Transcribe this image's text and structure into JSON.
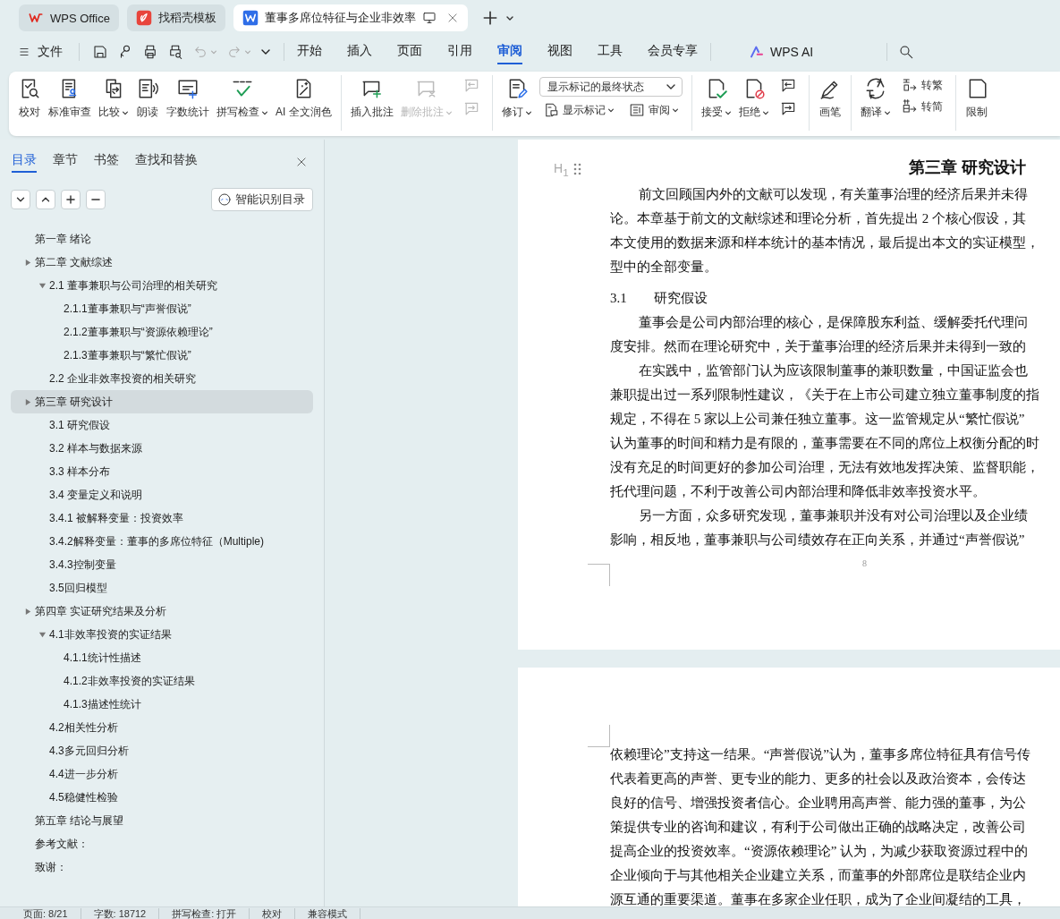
{
  "tabs": [
    {
      "label": "WPS Office",
      "kind": "wps",
      "selected": false
    },
    {
      "label": "找稻壳模板",
      "kind": "docer",
      "selected": false
    },
    {
      "label": "董事多席位特征与企业非效率",
      "kind": "doc",
      "selected": true
    }
  ],
  "menu": {
    "file": "文件",
    "tabs": [
      {
        "label": "开始",
        "selected": false
      },
      {
        "label": "插入",
        "selected": false
      },
      {
        "label": "页面",
        "selected": false
      },
      {
        "label": "引用",
        "selected": false
      },
      {
        "label": "审阅",
        "selected": true
      },
      {
        "label": "视图",
        "selected": false
      },
      {
        "label": "工具",
        "selected": false
      },
      {
        "label": "会员专享",
        "selected": false
      }
    ],
    "ai": "WPS AI"
  },
  "ribbon": {
    "groups": [
      {
        "items": [
          {
            "kind": "large",
            "label": "校对",
            "dropdown": false,
            "disabled": false
          },
          {
            "kind": "large",
            "label": "标准审查",
            "dropdown": false,
            "disabled": false
          },
          {
            "kind": "large",
            "label": "比较",
            "dropdown": true,
            "disabled": false
          },
          {
            "kind": "large",
            "label": "朗读",
            "dropdown": false,
            "disabled": false
          },
          {
            "kind": "large",
            "label": "字数统计",
            "dropdown": false,
            "disabled": false
          },
          {
            "kind": "large",
            "label": "拼写检查",
            "dropdown": true,
            "disabled": false
          },
          {
            "kind": "large",
            "label": "AI 全文润色",
            "dropdown": false,
            "disabled": false
          }
        ]
      },
      {
        "items": [
          {
            "kind": "large",
            "label": "插入批注",
            "dropdown": false,
            "disabled": false
          },
          {
            "kind": "large",
            "label": "删除批注",
            "dropdown": true,
            "disabled": true
          },
          {
            "kind": "stack",
            "items": [
              {
                "kind": "icon",
                "disabled": true
              },
              {
                "kind": "icon",
                "disabled": true
              }
            ]
          }
        ]
      },
      {
        "items": [
          {
            "kind": "large",
            "label": "修订",
            "dropdown": true,
            "disabled": false
          },
          {
            "kind": "stack",
            "items": [
              {
                "kind": "select",
                "value": "显示标记的最终状态"
              },
              {
                "kind": "row",
                "items": [
                  {
                    "kind": "small",
                    "label": "显示标记",
                    "dropdown": true,
                    "disabled": false
                  },
                  {
                    "kind": "small",
                    "label": "审阅",
                    "dropdown": true,
                    "disabled": false
                  }
                ]
              }
            ]
          }
        ]
      },
      {
        "items": [
          {
            "kind": "large",
            "label": "接受",
            "dropdown": true,
            "disabled": false
          },
          {
            "kind": "large",
            "label": "拒绝",
            "dropdown": true,
            "disabled": false
          },
          {
            "kind": "stack",
            "items": [
              {
                "kind": "icon",
                "disabled": false
              },
              {
                "kind": "icon",
                "disabled": false
              }
            ]
          }
        ]
      },
      {
        "items": [
          {
            "kind": "large",
            "label": "画笔",
            "dropdown": false,
            "disabled": false
          }
        ]
      },
      {
        "items": [
          {
            "kind": "large",
            "label": "翻译",
            "dropdown": true,
            "disabled": false
          },
          {
            "kind": "stack",
            "items": [
              {
                "kind": "small",
                "label": "转繁",
                "dropdown": false,
                "disabled": false
              },
              {
                "kind": "small",
                "label": "转简",
                "dropdown": false,
                "disabled": false
              }
            ]
          }
        ]
      },
      {
        "items": [
          {
            "kind": "large",
            "label": "限制",
            "dropdown": false,
            "disabled": false
          }
        ]
      }
    ]
  },
  "sidebar": {
    "tabs": [
      {
        "label": "目录",
        "selected": true
      },
      {
        "label": "章节",
        "selected": false
      },
      {
        "label": "书签",
        "selected": false
      },
      {
        "label": "查找和替换",
        "selected": false
      }
    ],
    "smart_toc": "智能识别目录",
    "toc": [
      {
        "label": "第一章  绪论",
        "selected": false
      },
      {
        "label": "第二章  文献综述",
        "selected": false,
        "expanded": false,
        "children": [
          {
            "label": "2.1  董事兼职与公司治理的相关研究",
            "selected": false,
            "expanded": true,
            "children": [
              {
                "label": "2.1.1董事兼职与“声誉假说”",
                "selected": false
              },
              {
                "label": "2.1.2董事兼职与“资源依赖理论”",
                "selected": false
              },
              {
                "label": "2.1.3董事兼职与“繁忙假说”",
                "selected": false
              }
            ]
          },
          {
            "label": "2.2  企业非效率投资的相关研究",
            "selected": false
          }
        ]
      },
      {
        "label": "第三章  研究设计",
        "selected": true,
        "expanded": false,
        "children": [
          {
            "label": "3.1  研究假设",
            "selected": false
          },
          {
            "label": "3.2  样本与数据来源",
            "selected": false
          },
          {
            "label": "3.3  样本分布",
            "selected": false
          },
          {
            "label": "3.4  变量定义和说明",
            "selected": false
          },
          {
            "label": "3.4.1  被解释变量：投资效率",
            "selected": false
          },
          {
            "label": "3.4.2解释变量：董事的多席位特征（Multiple)",
            "selected": false
          },
          {
            "label": "3.4.3控制变量",
            "selected": false
          },
          {
            "label": "3.5回归模型",
            "selected": false
          }
        ]
      },
      {
        "label": "第四章  实证研究结果及分析",
        "selected": false,
        "expanded": false,
        "children": [
          {
            "label": "4.1非效率投资的实证结果",
            "selected": false,
            "expanded": true,
            "children": [
              {
                "label": "4.1.1统计性描述",
                "selected": false
              },
              {
                "label": "4.1.2非效率投资的实证结果",
                "selected": false
              },
              {
                "label": "4.1.3描述性统计",
                "selected": false
              }
            ]
          },
          {
            "label": "4.2相关性分析",
            "selected": false
          },
          {
            "label": "4.3多元回归分析",
            "selected": false
          },
          {
            "label": "4.4进一步分析",
            "selected": false
          },
          {
            "label": "4.5稳健性检验",
            "selected": false
          }
        ]
      },
      {
        "label": "第五章  结论与展望",
        "selected": false
      },
      {
        "label": "参考文献：",
        "selected": false
      },
      {
        "label": "致谢：",
        "selected": false
      }
    ]
  },
  "document": {
    "pages": [
      {
        "heading_marker": "H$_{1}$",
        "page_number": "8",
        "blocks": [
          {
            "kind": "title",
            "text": "第三章  研究设计"
          },
          {
            "kind": "para",
            "lines": [
              "前文回顾国内外的文献可以发现，有关董事治理的经济后果并未得",
              "论。本章基于前文的文献综述和理论分析，首先提出 2 个核心假设，其",
              "本文使用的数据来源和样本统计的基本情况，最后提出本文的实证模型，",
              "型中的全部变量。"
            ]
          },
          {
            "kind": "section",
            "number": "3.1",
            "text": "研究假设"
          },
          {
            "kind": "para",
            "lines": [
              "董事会是公司内部治理的核心，是保障股东利益、缓解委托代理问",
              "度安排。然而在理论研究中，关于董事治理的经济后果并未得到一致的"
            ]
          },
          {
            "kind": "para",
            "lines": [
              "在实践中，监管部门认为应该限制董事的兼职数量，中国证监会也",
              "兼职提出过一系列限制性建议，《关于在上市公司建立独立董事制度的指",
              "规定，不得在 5 家以上公司兼任独立董事。这一监管规定从“繁忙假说”",
              "认为董事的时间和精力是有限的，董事需要在不同的席位上权衡分配的时",
              "没有充足的时间更好的参加公司治理，无法有效地发挥决策、监督职能，",
              "托代理问题，不利于改善公司内部治理和降低非效率投资水平。"
            ]
          },
          {
            "kind": "para",
            "lines": [
              "另一方面，众多研究发现，董事兼职并没有对公司治理以及企业绩",
              "影响，相反地，董事兼职与公司绩效存在正向关系，并通过“声誉假说”"
            ]
          }
        ]
      },
      {
        "blocks": [
          {
            "kind": "continued",
            "lines": [
              "依赖理论”支持这一结果。“声誉假说”认为，董事多席位特征具有信号传",
              "代表着更高的声誉、更专业的能力、更多的社会以及政治资本，会传达",
              "良好的信号、增强投资者信心。企业聘用高声誉、能力强的董事，为公",
              "策提供专业的咨询和建议，有利于公司做出正确的战略决定，改善公司",
              "提高企业的投资效率。“资源依赖理论” 认为，为减少获取资源过程中的",
              "企业倾向于与其他相关企业建立关系，而董事的外部席位是联结企业内",
              "源互通的重要渠道。董事在多家企业任职，成为了企业间凝结的工具，"
            ]
          }
        ]
      }
    ]
  },
  "status_bar": [
    "页面: 8/21",
    "字数: 18712",
    "拼写检查: 打开",
    "校对",
    "兼容模式"
  ]
}
